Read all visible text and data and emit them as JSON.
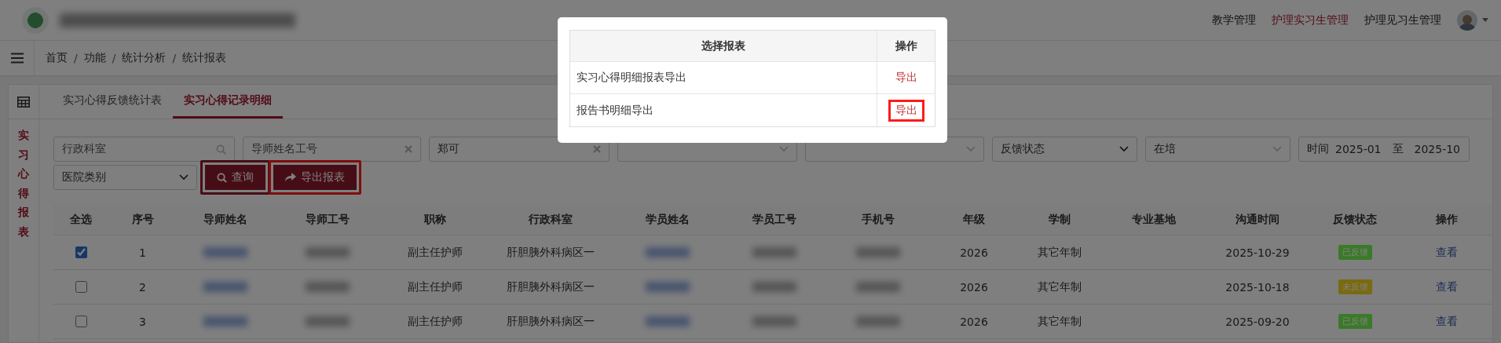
{
  "header": {
    "nav": [
      {
        "label": "教学管理",
        "selected": false
      },
      {
        "label": "护理实习生管理",
        "selected": true
      },
      {
        "label": "护理见习生管理",
        "selected": false
      }
    ]
  },
  "breadcrumb": {
    "separator": "/",
    "items": [
      "首页",
      "功能",
      "统计分析",
      "统计报表"
    ]
  },
  "sidebar": {
    "title": "实习心得报表"
  },
  "tabs": [
    {
      "label": "实习心得反馈统计表",
      "selected": false
    },
    {
      "label": "实习心得记录明细",
      "selected": true
    }
  ],
  "filters": [
    {
      "kind": "search",
      "placeholder": "行政科室"
    },
    {
      "kind": "clearable",
      "placeholder": "导师姓名工号"
    },
    {
      "kind": "clearable",
      "value": "郑可"
    },
    {
      "kind": "select"
    },
    {
      "kind": "select"
    },
    {
      "kind": "native",
      "value": "反馈状态"
    },
    {
      "kind": "select",
      "value": "在培"
    },
    {
      "kind": "daterange",
      "label": "时间",
      "from": "2025-01",
      "separator": "至",
      "to": "2025-10"
    },
    {
      "kind": "native",
      "value": "医院类别"
    }
  ],
  "buttons": [
    {
      "kind": "search",
      "label": "查询",
      "highlighted": false
    },
    {
      "kind": "export",
      "label": "导出报表",
      "highlighted": true
    }
  ],
  "table": {
    "columns": [
      {
        "label": "全选",
        "kind": "checkbox"
      },
      {
        "label": "序号",
        "kind": "no"
      },
      {
        "label": "导师姓名",
        "kind": "blur-link"
      },
      {
        "label": "导师工号",
        "kind": "blur"
      },
      {
        "label": "职称",
        "kind": "title"
      },
      {
        "label": "行政科室",
        "kind": "department"
      },
      {
        "label": "学员姓名",
        "kind": "blur-link"
      },
      {
        "label": "学员工号",
        "kind": "blur"
      },
      {
        "label": "手机号",
        "kind": "blur"
      },
      {
        "label": "年级",
        "kind": "grade"
      },
      {
        "label": "学制",
        "kind": "program"
      },
      {
        "label": "专业基地",
        "kind": "base"
      },
      {
        "label": "沟通时间",
        "kind": "date"
      },
      {
        "label": "反馈状态",
        "kind": "status"
      },
      {
        "label": "操作",
        "kind": "action"
      }
    ],
    "rows": [
      {
        "checked": true,
        "no": "1",
        "title": "副主任护师",
        "department": "肝胆胰外科病区一",
        "grade": "2026",
        "program": "其它年制",
        "date": "2025-10-29",
        "status": {
          "label": "已反馈",
          "color": "#3a7a28"
        },
        "action": "查看"
      },
      {
        "checked": false,
        "no": "2",
        "title": "副主任护师",
        "department": "肝胆胰外科病区一",
        "grade": "2026",
        "program": "其它年制",
        "date": "2025-10-18",
        "status": {
          "label": "未反馈",
          "color": "#7a6a10"
        },
        "action": "查看"
      },
      {
        "checked": false,
        "no": "3",
        "title": "副主任护师",
        "department": "肝胆胰外科病区一",
        "grade": "2026",
        "program": "其它年制",
        "date": "2025-09-20",
        "status": {
          "label": "已反馈",
          "color": "#3a7a28"
        },
        "action": "查看"
      }
    ]
  },
  "modal": {
    "columns": [
      "选择报表",
      "操作"
    ],
    "rows": [
      {
        "label": "实习心得明细报表导出",
        "action": "导出",
        "highlighted": false
      },
      {
        "label": "报告书明细导出",
        "action": "导出",
        "highlighted": true
      }
    ]
  }
}
